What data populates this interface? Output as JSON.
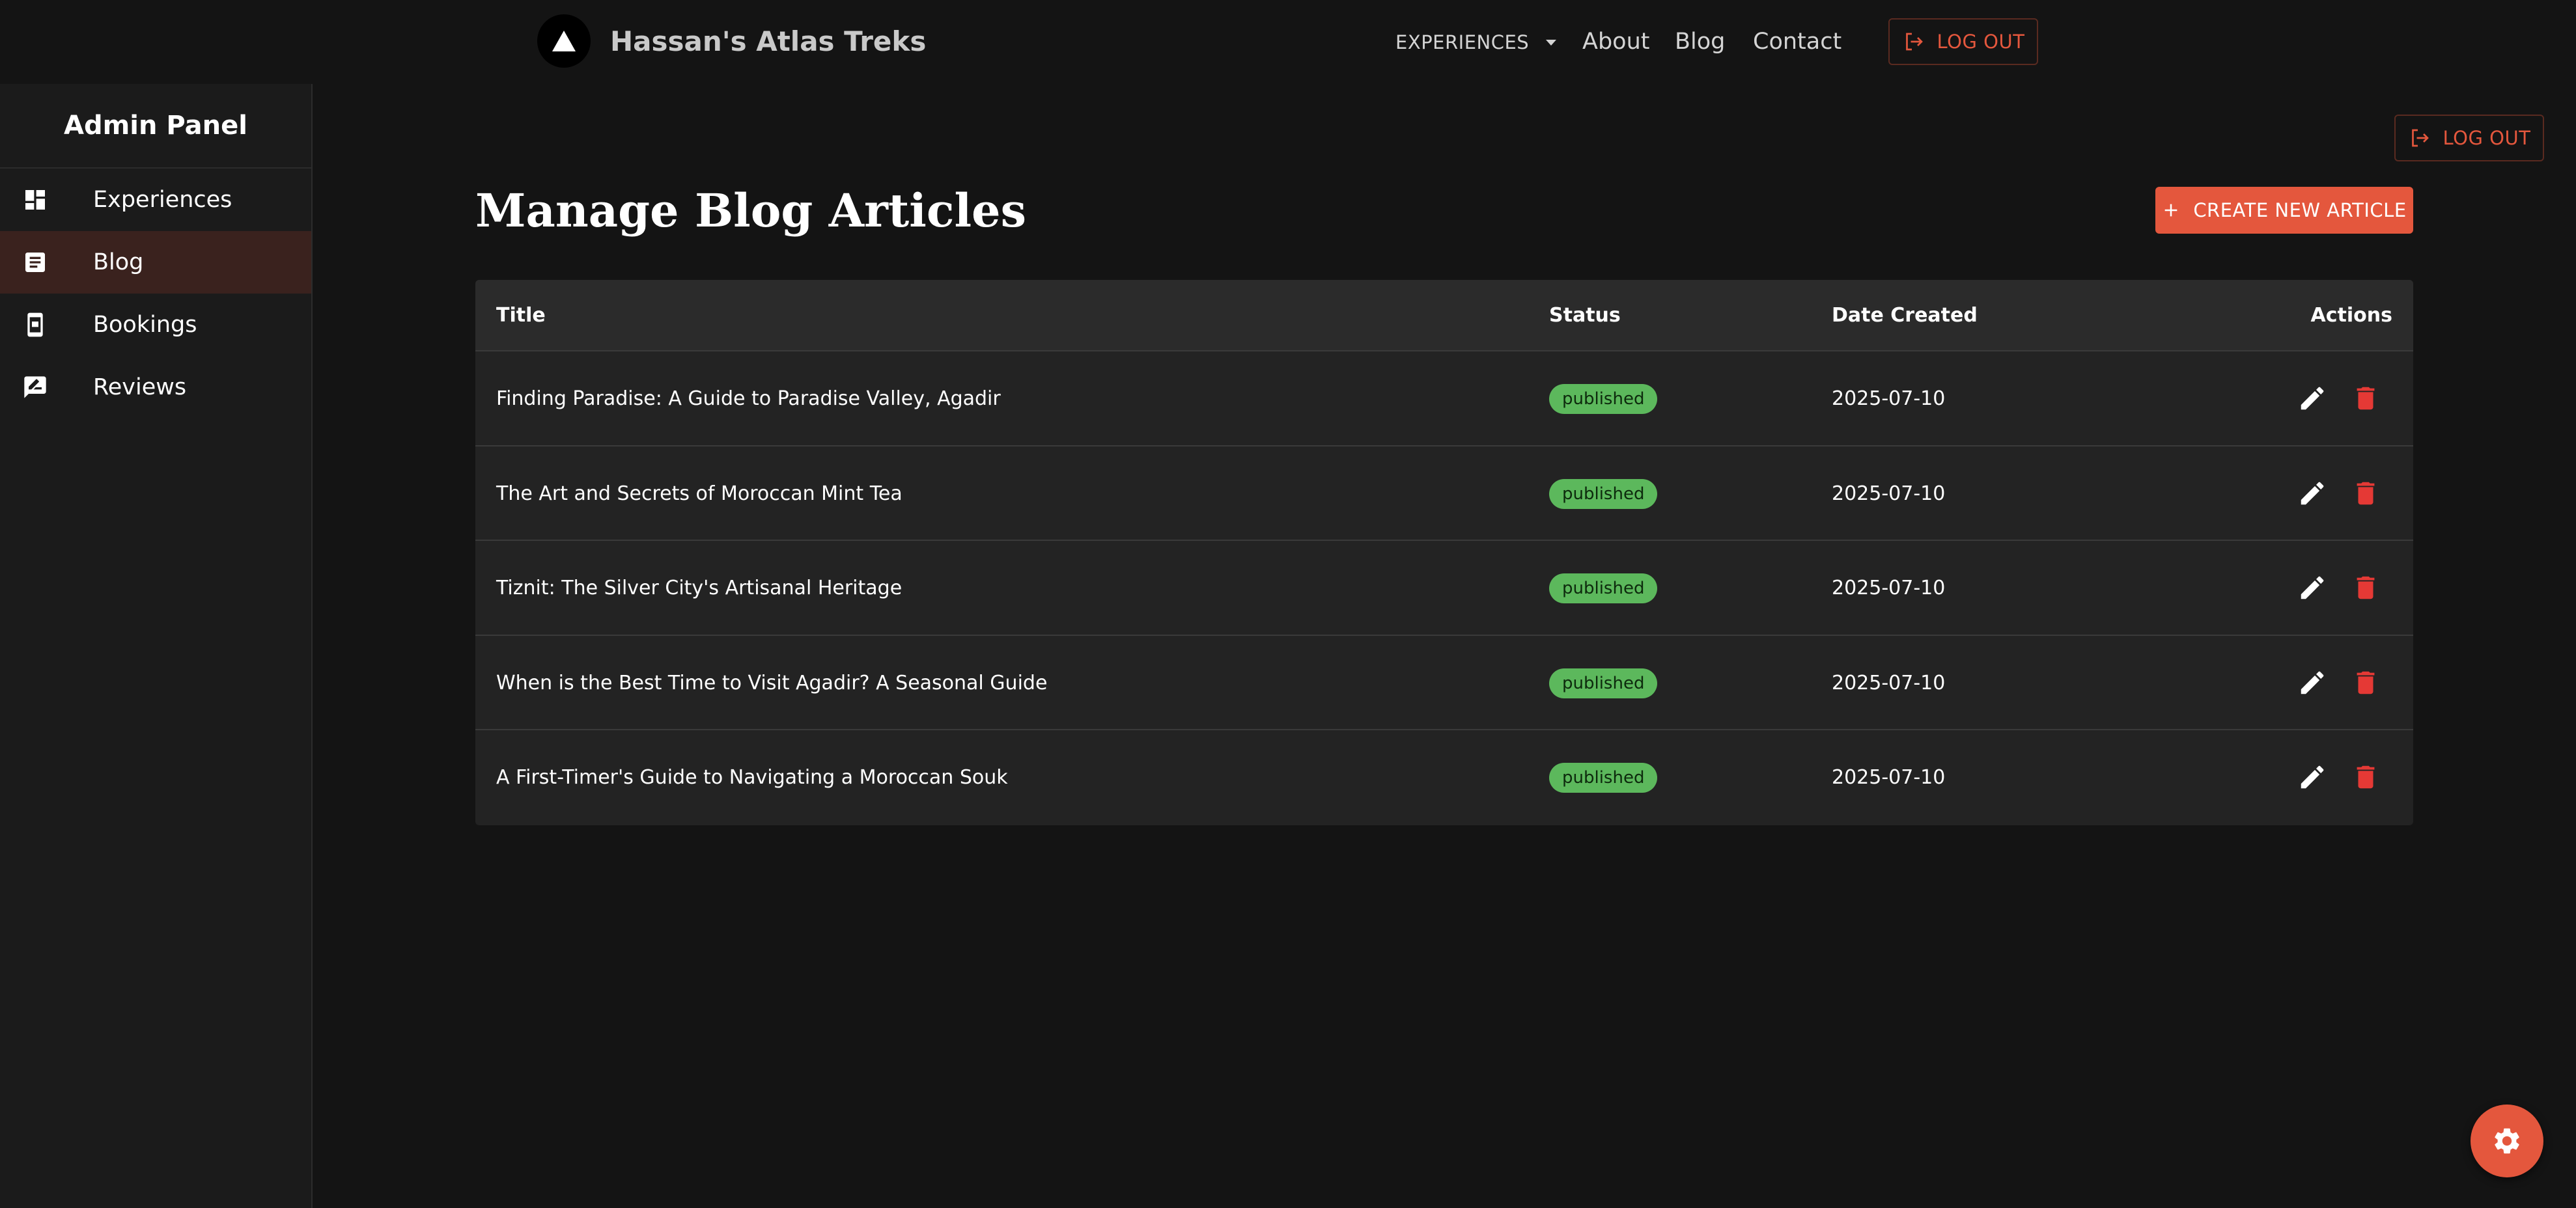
{
  "brand": {
    "name": "Hassan's Atlas Treks"
  },
  "nav": {
    "experiences_label": "EXPERIENCES",
    "about_label": "About",
    "blog_label": "Blog",
    "contact_label": "Contact",
    "logout_label": "LOG OUT"
  },
  "sidebar": {
    "title": "Admin Panel",
    "items": [
      {
        "label": "Experiences",
        "icon": "dashboard-icon",
        "active": false
      },
      {
        "label": "Blog",
        "icon": "article-icon",
        "active": true
      },
      {
        "label": "Bookings",
        "icon": "booking-icon",
        "active": false
      },
      {
        "label": "Reviews",
        "icon": "rate-review-icon",
        "active": false
      }
    ]
  },
  "main": {
    "logout_label": "LOG OUT",
    "page_title": "Manage Blog Articles",
    "create_label": "CREATE NEW ARTICLE",
    "table": {
      "headers": {
        "title": "Title",
        "status": "Status",
        "date": "Date Created",
        "actions": "Actions"
      },
      "rows": [
        {
          "title": "Finding Paradise: A Guide to Paradise Valley, Agadir",
          "status": "published",
          "date": "2025-07-10"
        },
        {
          "title": "The Art and Secrets of Moroccan Mint Tea",
          "status": "published",
          "date": "2025-07-10"
        },
        {
          "title": "Tiznit: The Silver City's Artisanal Heritage",
          "status": "published",
          "date": "2025-07-10"
        },
        {
          "title": "When is the Best Time to Visit Agadir? A Seasonal Guide",
          "status": "published",
          "date": "2025-07-10"
        },
        {
          "title": "A First-Timer's Guide to Navigating a Moroccan Souk",
          "status": "published",
          "date": "2025-07-10"
        }
      ]
    }
  },
  "colors": {
    "accent": "#e4573d",
    "background": "#141414",
    "sidebar": "#1b1b1b",
    "table": "#232323",
    "status_published": "#5cb85c"
  },
  "fab": {
    "icon": "gear-icon"
  }
}
